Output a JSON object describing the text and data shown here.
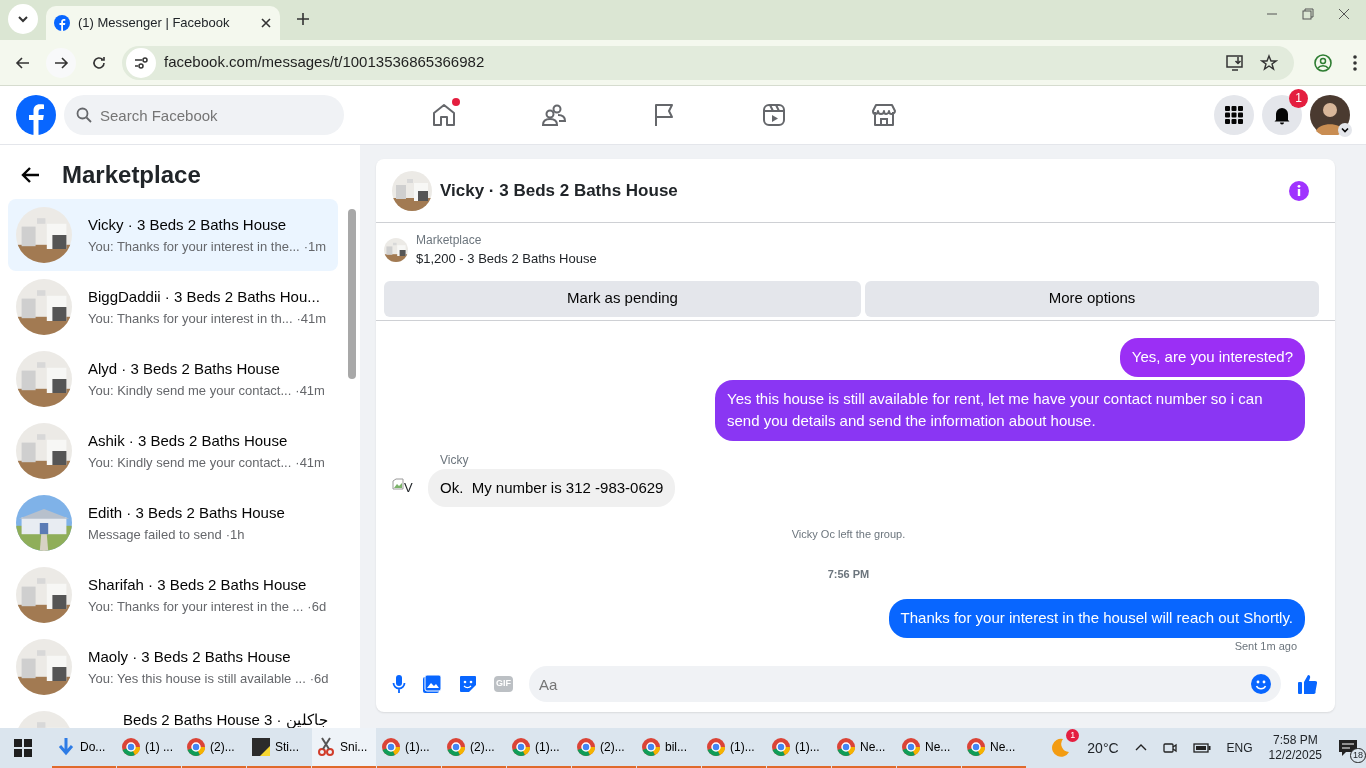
{
  "browser": {
    "tab_title": "(1) Messenger | Facebook",
    "url": "facebook.com/messages/t/10013536865366982"
  },
  "facebook_nav": {
    "search_placeholder": "Search Facebook",
    "home_unread": true,
    "notification_count": "1"
  },
  "sidebar": {
    "title": "Marketplace",
    "conversations": [
      {
        "name": "Vicky · 3 Beds 2 Baths House",
        "preview": "You: Thanks for your interest in the...",
        "time": "·1m",
        "selected": true
      },
      {
        "name": "BiggDaddii · 3 Beds 2 Baths Hou...",
        "preview": "You: Thanks for your interest in th...",
        "time": "·41m",
        "selected": false
      },
      {
        "name": "Alyd · 3 Beds 2 Baths House",
        "preview": "You: Kindly send me your contact...",
        "time": "·41m",
        "selected": false
      },
      {
        "name": "Ashik · 3 Beds 2 Baths House",
        "preview": "You: Kindly send me your contact...",
        "time": "·41m",
        "selected": false
      },
      {
        "name": "Edith · 3 Beds 2 Baths House",
        "preview": "Message failed to send",
        "time": "·1h",
        "selected": false
      },
      {
        "name": "Sharifah · 3 Beds 2 Baths House",
        "preview": "You: Thanks for your interest in the ...",
        "time": "·6d",
        "selected": false
      },
      {
        "name": "Maoly · 3 Beds 2 Baths House",
        "preview": "You: Yes this house is still available ...",
        "time": "·6d",
        "selected": false
      },
      {
        "name": "Beds 2 Baths House 3 · جاكلين",
        "selected": false
      }
    ]
  },
  "chat": {
    "title": "Vicky · 3 Beds 2 Baths House",
    "listing": {
      "label": "Marketplace",
      "summary": "$1,200 - 3 Beds 2 Baths House"
    },
    "actions": [
      "Mark as pending",
      "More options"
    ],
    "messages": [
      {
        "kind": "outgoing",
        "text": "Yes, are you interested?",
        "color": "#9b2ff5"
      },
      {
        "kind": "outgoing",
        "text": "Yes this house is still available for rent, let me have your contact number so i can send you details and send the information about house.",
        "color": "#8a36f3"
      },
      {
        "kind": "incoming",
        "sender": "Vicky",
        "avatar_alt": "V",
        "text": "Ok.  My number is 312 -983-0629"
      },
      {
        "kind": "system",
        "text": "Vicky Oc left the group."
      },
      {
        "kind": "time",
        "text": "7:56 PM"
      },
      {
        "kind": "outgoing",
        "text": "Thanks for your interest in the housel will reach out Shortly.",
        "color": "#0866ff",
        "status": "Sent 1m ago"
      }
    ],
    "composer": {
      "gif_label": "GIF",
      "placeholder": "Aa"
    }
  },
  "taskbar": {
    "apps": [
      {
        "kind": "download",
        "label": "Do...",
        "selected": false
      },
      {
        "kind": "chrome",
        "label": "(1) ...",
        "selected": false
      },
      {
        "kind": "chrome",
        "label": "(2)...",
        "selected": false
      },
      {
        "kind": "sticky",
        "label": "Sti...",
        "selected": false
      },
      {
        "kind": "snip",
        "label": "Sni...",
        "selected": true
      },
      {
        "kind": "chrome",
        "label": "(1)...",
        "selected": false
      },
      {
        "kind": "chrome",
        "label": "(2)...",
        "selected": false
      },
      {
        "kind": "chrome",
        "label": "(1)...",
        "selected": false
      },
      {
        "kind": "chrome",
        "label": "(2)...",
        "selected": false
      },
      {
        "kind": "chrome",
        "label": "bil...",
        "selected": false
      },
      {
        "kind": "chrome",
        "label": "(1)...",
        "selected": false
      },
      {
        "kind": "chrome",
        "label": "(1)...",
        "selected": false
      },
      {
        "kind": "chrome",
        "label": "Ne...",
        "selected": false
      },
      {
        "kind": "chrome",
        "label": "Ne...",
        "selected": false
      },
      {
        "kind": "chrome",
        "label": "Ne...",
        "selected": false
      }
    ],
    "weather_badge": "1",
    "temperature": "20°C",
    "language": "ENG",
    "time": "7:58 PM",
    "date": "12/2/2025",
    "notifications": "18"
  }
}
